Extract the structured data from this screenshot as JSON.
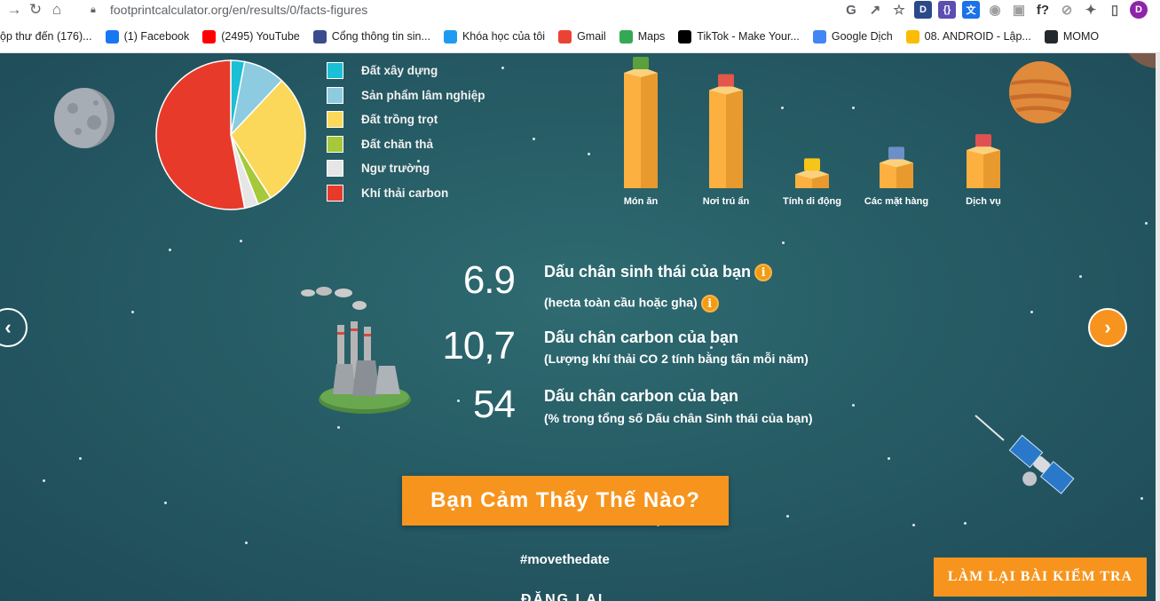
{
  "browser": {
    "url": "footprintcalculator.org/en/results/0/facts-figures",
    "bookmarks": [
      {
        "label": "ộp thư đến (176)...",
        "icon": "inbox-icon",
        "color": "#ffffff"
      },
      {
        "label": "(1) Facebook",
        "icon": "facebook-icon",
        "color": "#1877f2"
      },
      {
        "label": "(2495) YouTube",
        "icon": "youtube-icon",
        "color": "#ff0000"
      },
      {
        "label": "Cổng thông tin sin...",
        "icon": "portal-icon",
        "color": "#3b4c8c"
      },
      {
        "label": "Khóa học của tôi",
        "icon": "course-icon",
        "color": "#1d9bf0"
      },
      {
        "label": "Gmail",
        "icon": "gmail-icon",
        "color": "#ea4335"
      },
      {
        "label": "Maps",
        "icon": "maps-icon",
        "color": "#34a853"
      },
      {
        "label": "TikTok - Make Your...",
        "icon": "tiktok-icon",
        "color": "#000000"
      },
      {
        "label": "Google Dịch",
        "icon": "translate-icon",
        "color": "#4285f4"
      },
      {
        "label": "08. ANDROID - Lập...",
        "icon": "drive-icon",
        "color": "#fbbc04"
      },
      {
        "label": "MOMO",
        "icon": "github-icon",
        "color": "#24292e"
      }
    ],
    "extensions": [
      {
        "icon": "translate-page-icon",
        "text": "G",
        "color": "#5f6368"
      },
      {
        "icon": "share-icon",
        "text": "↗",
        "color": "#5f6368"
      },
      {
        "icon": "bookmark-star-icon",
        "text": "☆",
        "color": "#5f6368"
      },
      {
        "icon": "d-extension-icon",
        "text": "D",
        "color": "#2b4a8b"
      },
      {
        "icon": "json-extension-icon",
        "text": "{}",
        "color": "#5c4db1"
      },
      {
        "icon": "translate-extension-icon",
        "text": "文",
        "color": "#1a73e8"
      },
      {
        "icon": "bot-extension-icon",
        "text": "◉",
        "color": "#9e9e9e"
      },
      {
        "icon": "screenshot-extension-icon",
        "text": "▣",
        "color": "#9e9e9e"
      },
      {
        "icon": "formula-extension-icon",
        "text": "f?",
        "color": "#333333"
      },
      {
        "icon": "compass-extension-icon",
        "text": "⊘",
        "color": "#9e9e9e"
      },
      {
        "icon": "puzzle-icon",
        "text": "✦",
        "color": "#5f6368"
      },
      {
        "icon": "sidepanel-icon",
        "text": "▯",
        "color": "#5f6368"
      },
      {
        "icon": "profile-avatar",
        "text": "D",
        "color": "#8e24aa"
      }
    ]
  },
  "pie": {
    "slices": [
      {
        "label": "Đất xây dựng",
        "value": 3,
        "color": "#1bbfd6"
      },
      {
        "label": "Sản phẩm lâm nghiệp",
        "value": 9,
        "color": "#8ccbe0"
      },
      {
        "label": "Đất trồng trọt",
        "value": 29,
        "color": "#fbd85a"
      },
      {
        "label": "Đất chăn thả",
        "value": 3,
        "color": "#a5c93a"
      },
      {
        "label": "Ngư trường",
        "value": 3,
        "color": "#e6e6e6"
      },
      {
        "label": "Khí thải carbon",
        "value": 53,
        "color": "#e83a2b"
      }
    ]
  },
  "categories": [
    {
      "label": "Món ăn",
      "level": 1.0,
      "icon": "grass-top-icon"
    },
    {
      "label": "Nơi trú ẩn",
      "level": 0.85,
      "icon": "house-icon"
    },
    {
      "label": "Tính di động",
      "level": 0.12,
      "icon": "taxi-icon"
    },
    {
      "label": "Các mặt hàng",
      "level": 0.22,
      "icon": "computer-icon"
    },
    {
      "label": "Dịch vụ",
      "level": 0.33,
      "icon": "shop-icon"
    }
  ],
  "stats": [
    {
      "value": "6.9",
      "title": "Dấu chân sinh thái của bạn",
      "subtitle": "(hecta toàn cầu hoặc gha)"
    },
    {
      "value": "10,7",
      "title": "Dấu chân carbon của bạn",
      "subtitle": "(Lượng khí thải CO 2 tính bằng tấn mỗi năm)"
    },
    {
      "value": "54",
      "title": "Dấu chân carbon của bạn",
      "subtitle": "(% trong tổng số Dấu chân Sinh thái của bạn)"
    }
  ],
  "info_glyph": "i",
  "cta_label": "Bạn Cảm Thấy Thế Nào?",
  "hashtag": "#movethedate",
  "share_label": "ĐĂNG LẠI",
  "retake_label": "LÀM LẠI BÀI KIỂM TRA",
  "nav": {
    "prev": "‹",
    "next": "›"
  }
}
